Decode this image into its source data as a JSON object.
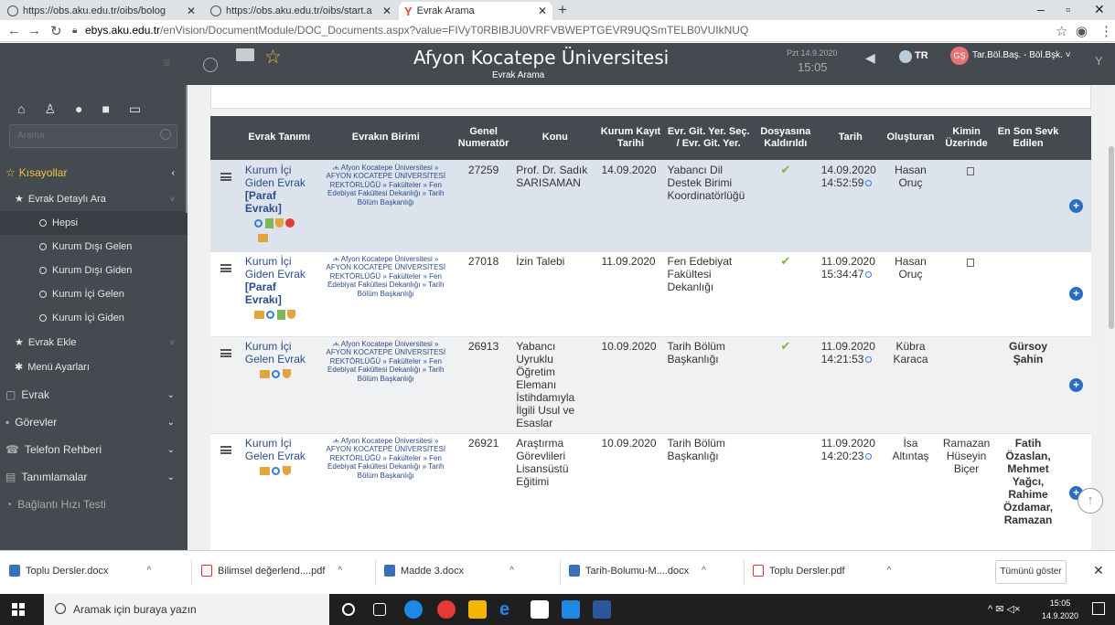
{
  "browser": {
    "tabs": [
      {
        "label": "https://obs.aku.edu.tr/oibs/bolog"
      },
      {
        "label": "https://obs.aku.edu.tr/oibs/start.a"
      },
      {
        "label": "Evrak Arama"
      }
    ],
    "url_host": "ebys.aku.edu.tr",
    "url_path": "/enVision/DocumentModule/DOC_Documents.aspx?value=FIVyT0RBIBJU0VRFVBWEPTGEVR9UQSmTELB0VUIkNUQ"
  },
  "header": {
    "title": "Afyon Kocatepe Üniversitesi",
    "subtitle": "Evrak Arama",
    "date": "Pzt 14.9.2020",
    "time": "15:05",
    "lang": "TR",
    "avatar": "GŞ",
    "user": "Tar.Böl.Baş. - Böl.Bşk. ˅"
  },
  "sidebar": {
    "search_placeholder": "Arama",
    "shortcuts": "Kısayollar",
    "detailed_search": "Evrak Detaylı Ara",
    "search_items": [
      "Hepsi",
      "Kurum Dışı Gelen",
      "Kurum Dışı Giden",
      "Kurum İçi Gelen",
      "Kurum İçi Giden"
    ],
    "add_doc": "Evrak Ekle",
    "menu_settings": "Menü Ayarları",
    "sections": [
      "Evrak",
      "Görevler",
      "Telefon Rehberi",
      "Tanımlamalar",
      "Bağlantı Hızı Testi"
    ]
  },
  "table": {
    "columns": [
      "Evrak Tanımı",
      "Evrakın Birimi",
      "Genel Numeratör",
      "Konu",
      "Kurum Kayıt Tarihi",
      "Evr. Git. Yer. Seç. / Evr. Git. Yer.",
      "Dosyasına Kaldırıldı",
      "Tarih",
      "Oluşturan",
      "Kimin Üzerinde",
      "En Son Sevk Edilen"
    ],
    "rows": [
      {
        "tanim": "Kurum İçi Giden Evrak",
        "tanim_extra": "[Paraf Evrakı]",
        "birim": "ሐ Afyon Kocatepe Üniversitesi » AFYON KOCATEPE ÜNİVERSİTESİ REKTÖRLÜĞÜ » Fakülteler » Fen Edebiyat Fakültesi Dekanlığı » Tarih Bölüm Başkanlığı",
        "numerator": "27259",
        "konu": "Prof. Dr. Sadık SARISAMAN",
        "kayit_tarihi": "14.09.2020",
        "git_yer": "Yabancı Dil Destek Birimi Koordinatörlüğü",
        "dosya": "✔",
        "tarih": "14.09.2020 14:52:59",
        "olusturan": "Hasan Oruç",
        "kimin": "",
        "sevk": ""
      },
      {
        "tanim": "Kurum İçi Giden Evrak",
        "tanim_extra": "[Paraf Evrakı]",
        "birim": "ሐ Afyon Kocatepe Üniversitesi » AFYON KOCATEPE ÜNİVERSİTESİ REKTÖRLÜĞÜ » Fakülteler » Fen Edebiyat Fakültesi Dekanlığı » Tarih Bölüm Başkanlığı",
        "numerator": "27018",
        "konu": "İzin Talebi",
        "kayit_tarihi": "11.09.2020",
        "git_yer": "Fen Edebiyat Fakültesi Dekanlığı",
        "dosya": "✔",
        "tarih": "11.09.2020 15:34:47",
        "olusturan": "Hasan Oruç",
        "kimin": "",
        "sevk": ""
      },
      {
        "tanim": "Kurum İçi Gelen Evrak",
        "tanim_extra": "",
        "birim": "ሐ Afyon Kocatepe Üniversitesi » AFYON KOCATEPE ÜNİVERSİTESİ REKTÖRLÜĞÜ » Fakülteler » Fen Edebiyat Fakültesi Dekanlığı » Tarih Bölüm Başkanlığı",
        "numerator": "26913",
        "konu": "Yabancı Uyruklu Öğretim Elemanı İstihdamıyla İlgili Usul ve Esaslar",
        "kayit_tarihi": "10.09.2020",
        "git_yer": "Tarih Bölüm Başkanlığı",
        "dosya": "✔",
        "tarih": "11.09.2020 14:21:53",
        "olusturan": "Kübra Karaca",
        "kimin": "",
        "sevk": "Gürsoy Şahin"
      },
      {
        "tanim": "Kurum İçi Gelen Evrak",
        "tanim_extra": "",
        "birim": "ሐ Afyon Kocatepe Üniversitesi » AFYON KOCATEPE ÜNİVERSİTESİ REKTÖRLÜĞÜ » Fakülteler » Fen Edebiyat Fakültesi Dekanlığı » Tarih Bölüm Başkanlığı",
        "numerator": "26921",
        "konu": "Araştırma Görevlileri Lisansüstü Eğitimi",
        "kayit_tarihi": "10.09.2020",
        "git_yer": "Tarih Bölüm Başkanlığı",
        "dosya": "",
        "tarih": "11.09.2020 14:20:23",
        "olusturan": "İsa Altıntaş",
        "kimin": "Ramazan Hüseyin Biçer",
        "sevk": "Fatih Özaslan, Mehmet Yağcı, Rahime Özdamar, Ramazan"
      }
    ]
  },
  "downloads": {
    "items": [
      "Toplu Dersler.docx",
      "Bilimsel değerlend....pdf",
      "Madde 3.docx",
      "Tarih-Bolumu-M....docx",
      "Toplu Dersler.pdf"
    ],
    "show_all": "Tümünü göster"
  },
  "taskbar": {
    "search_placeholder": "Aramak için buraya yazın",
    "time": "15:05",
    "date": "14.9.2020"
  }
}
